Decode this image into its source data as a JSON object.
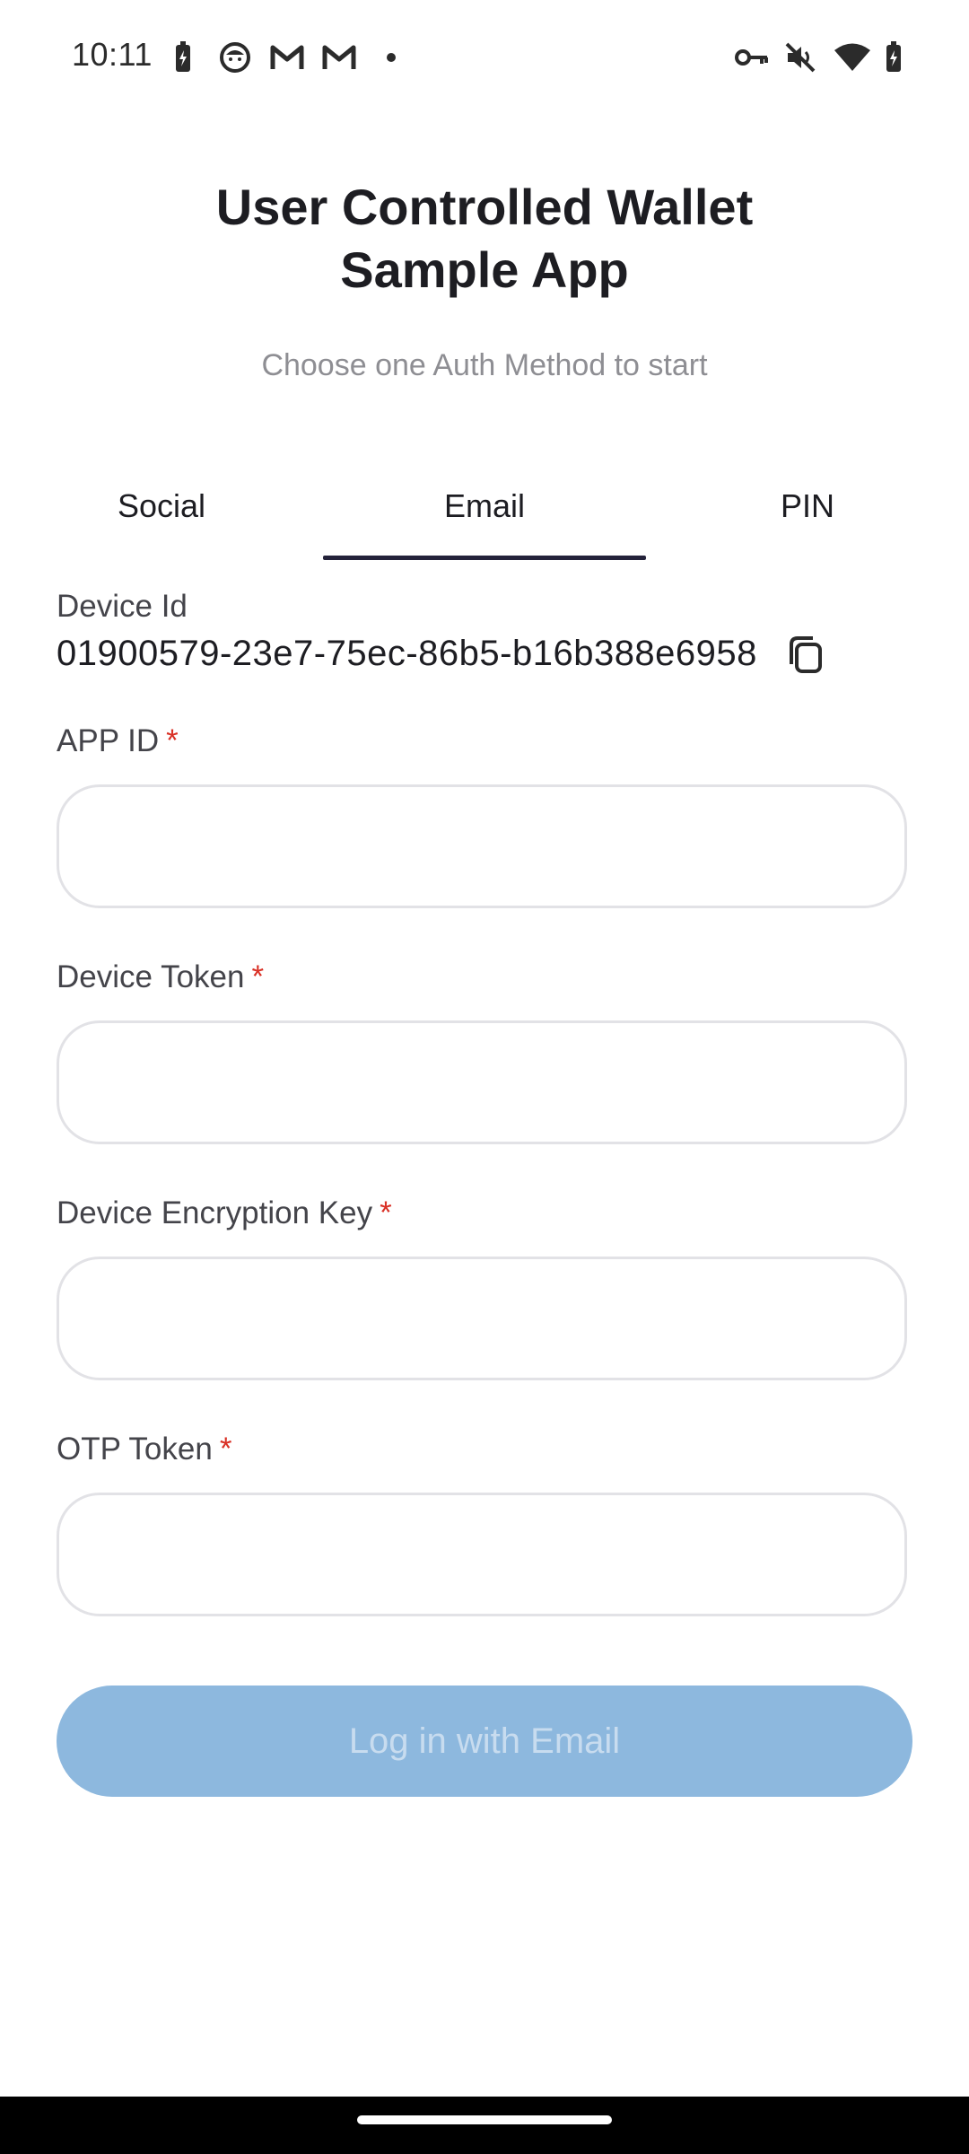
{
  "status_bar": {
    "time": "10:11",
    "left_icons": [
      "battery-charging-icon",
      "cat-face-icon",
      "gmail-icon",
      "gmail-icon",
      "dot-icon"
    ],
    "right_icons": [
      "vpn-key-icon",
      "mute-icon",
      "wifi-icon",
      "battery-icon"
    ]
  },
  "header": {
    "title_line1": "User Controlled Wallet",
    "title_line2": "Sample App",
    "subtitle": "Choose one Auth Method to start"
  },
  "tabs": [
    {
      "label": "Social",
      "selected": false
    },
    {
      "label": "Email",
      "selected": true
    },
    {
      "label": "PIN",
      "selected": false
    }
  ],
  "device": {
    "label": "Device Id",
    "value": "01900579-23e7-75ec-86b5-b16b388e6958",
    "copy_icon": "copy-icon"
  },
  "form": {
    "fields": [
      {
        "label": "APP ID",
        "required_mark": "*",
        "value": ""
      },
      {
        "label": "Device Token",
        "required_mark": "*",
        "value": ""
      },
      {
        "label": "Device Encryption Key",
        "required_mark": "*",
        "value": ""
      },
      {
        "label": "OTP Token",
        "required_mark": "*",
        "value": ""
      }
    ],
    "submit_label": "Log in with Email"
  },
  "colors": {
    "accent": "#24223a",
    "required": "#d93025",
    "button_disabled": "#8db8de"
  }
}
